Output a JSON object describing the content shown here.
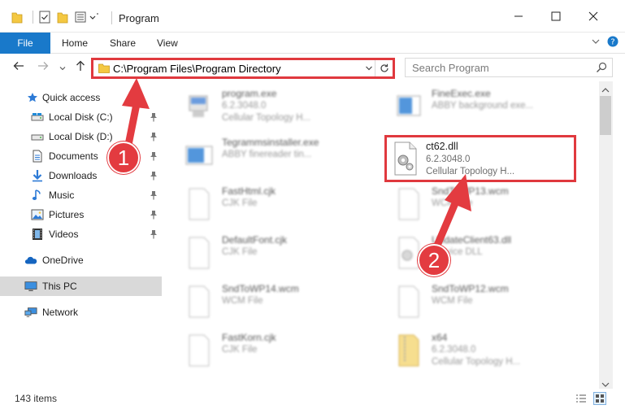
{
  "window": {
    "title": "Program",
    "minimize": "—",
    "maximize": "☐",
    "close": "✕"
  },
  "ribbon": {
    "file": "File",
    "home": "Home",
    "share": "Share",
    "view": "View",
    "expand": "⌄",
    "help": "?"
  },
  "address": {
    "path": "C:\\Program Files\\Program Directory",
    "dropdown": "⌄",
    "refresh": "↻"
  },
  "search": {
    "placeholder": "Search Program"
  },
  "nav": {
    "back": "←",
    "forward": "→",
    "recent": "⌄",
    "up": "↑"
  },
  "sidebar": {
    "items": [
      {
        "label": "Quick access"
      },
      {
        "label": "Local Disk (C:)"
      },
      {
        "label": "Local Disk (D:)"
      },
      {
        "label": "Documents"
      },
      {
        "label": "Downloads"
      },
      {
        "label": "Music"
      },
      {
        "label": "Pictures"
      },
      {
        "label": "Videos"
      },
      {
        "label": "OneDrive"
      },
      {
        "label": "This PC"
      },
      {
        "label": "Network"
      }
    ]
  },
  "files": [
    {
      "name": "program.exe",
      "line2": "6.2.3048.0",
      "line3": "Cellular Topology H..."
    },
    {
      "name": "FineExec.exe",
      "line2": "ABBY background exe..."
    },
    {
      "name": "Tegrammsinstaller.exe",
      "line2": "ABBY finereader tin..."
    },
    {
      "name": "ct62.dll",
      "line2": "6.2.3048.0",
      "line3": "Cellular Topology H..."
    },
    {
      "name": "FastHtml.cjk",
      "line2": "CJK File"
    },
    {
      "name": "SndToWP13.wcm",
      "line2": "WCM File"
    },
    {
      "name": "DefaultFont.cjk",
      "line2": "CJK File"
    },
    {
      "name": "UpdateClient63.dll",
      "line2": "Service DLL"
    },
    {
      "name": "SndToWP14.wcm",
      "line2": "WCM File"
    },
    {
      "name": "SndToWP12.wcm",
      "line2": "WCM File"
    },
    {
      "name": "FastKorn.cjk",
      "line2": "CJK File"
    },
    {
      "name": "x64",
      "line2": "6.2.3048.0",
      "line3": "Cellular Topology H..."
    }
  ],
  "status": {
    "count": "143 items"
  },
  "callouts": {
    "one": "1",
    "two": "2"
  },
  "colors": {
    "accent": "#1979ca",
    "highlight": "#e0393e",
    "folder": "#f4c842"
  }
}
